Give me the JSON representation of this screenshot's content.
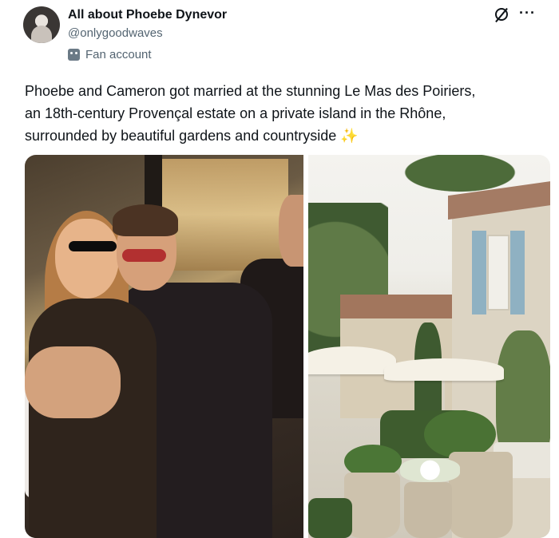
{
  "post": {
    "author_name": "All about Phoebe Dynevor",
    "handle": "@onlygoodwaves",
    "badge_label": "Fan account",
    "text_lines": [
      "Phoebe and Cameron  got married at the stunning Le Mas des Poiriers,",
      "an 18th-century Provençal estate on a private island in the Rhône,",
      "surrounded by beautiful gardens and countryside ✨"
    ],
    "icons": {
      "avatar": "profile-avatar",
      "badge": "fan-account-icon",
      "grok": "grok-icon",
      "more": "more-options-icon"
    },
    "more_glyph": "···",
    "media": [
      {
        "name": "couple-photo"
      },
      {
        "name": "estate-photo"
      }
    ]
  }
}
